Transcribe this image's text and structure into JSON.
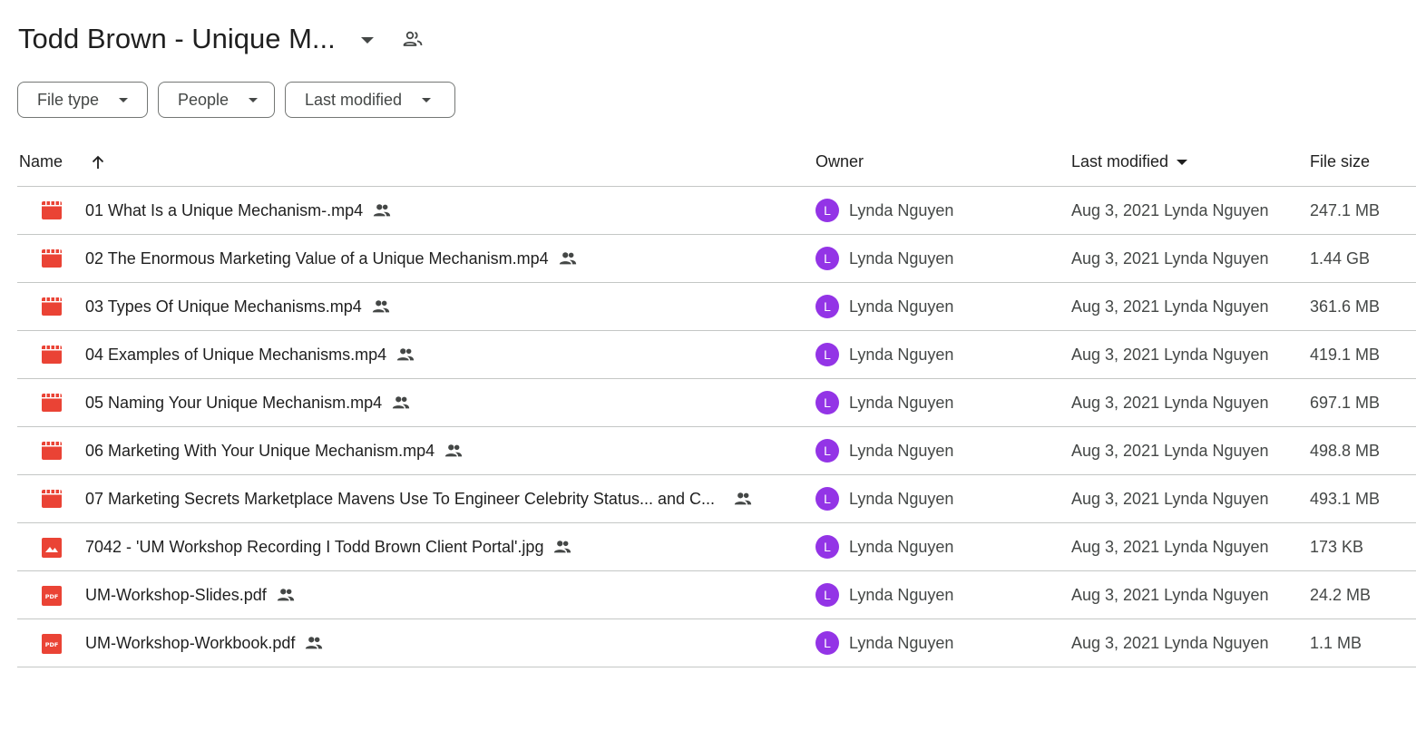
{
  "header": {
    "title": "Todd Brown - Unique M...",
    "title_dropdown_icon": "caret-down-icon",
    "shared_icon": "shared-people-icon"
  },
  "filters": [
    {
      "label": "File type"
    },
    {
      "label": "People"
    },
    {
      "label": "Last modified"
    }
  ],
  "columns": {
    "name": "Name",
    "owner": "Owner",
    "last_modified": "Last modified",
    "file_size": "File size"
  },
  "colors": {
    "video_icon": "#ea4335",
    "image_icon": "#ea4335",
    "pdf_icon": "#ea4335",
    "avatar": "#9334e6"
  },
  "files": [
    {
      "name": "01 What Is a Unique Mechanism-.mp4",
      "type": "video",
      "owner": "Lynda Nguyen",
      "owner_initial": "L",
      "modified": "Aug 3, 2021 Lynda Nguyen",
      "size": "247.1 MB"
    },
    {
      "name": "02 The Enormous Marketing Value of a Unique Mechanism.mp4",
      "type": "video",
      "owner": "Lynda Nguyen",
      "owner_initial": "L",
      "modified": "Aug 3, 2021 Lynda Nguyen",
      "size": "1.44 GB"
    },
    {
      "name": "03 Types Of Unique Mechanisms.mp4",
      "type": "video",
      "owner": "Lynda Nguyen",
      "owner_initial": "L",
      "modified": "Aug 3, 2021 Lynda Nguyen",
      "size": "361.6 MB"
    },
    {
      "name": "04 Examples of Unique Mechanisms.mp4",
      "type": "video",
      "owner": "Lynda Nguyen",
      "owner_initial": "L",
      "modified": "Aug 3, 2021 Lynda Nguyen",
      "size": "419.1 MB"
    },
    {
      "name": "05 Naming Your Unique Mechanism.mp4",
      "type": "video",
      "owner": "Lynda Nguyen",
      "owner_initial": "L",
      "modified": "Aug 3, 2021 Lynda Nguyen",
      "size": "697.1 MB"
    },
    {
      "name": "06 Marketing With Your Unique Mechanism.mp4",
      "type": "video",
      "owner": "Lynda Nguyen",
      "owner_initial": "L",
      "modified": "Aug 3, 2021 Lynda Nguyen",
      "size": "498.8 MB"
    },
    {
      "name": "07 Marketing Secrets Marketplace Mavens Use To Engineer Celebrity Status... and C...",
      "type": "video",
      "owner": "Lynda Nguyen",
      "owner_initial": "L",
      "modified": "Aug 3, 2021 Lynda Nguyen",
      "size": "493.1 MB"
    },
    {
      "name": "7042 - 'UM Workshop Recording I Todd Brown Client Portal'.jpg",
      "type": "image",
      "owner": "Lynda Nguyen",
      "owner_initial": "L",
      "modified": "Aug 3, 2021 Lynda Nguyen",
      "size": "173 KB"
    },
    {
      "name": "UM-Workshop-Slides.pdf",
      "type": "pdf",
      "owner": "Lynda Nguyen",
      "owner_initial": "L",
      "modified": "Aug 3, 2021 Lynda Nguyen",
      "size": "24.2 MB"
    },
    {
      "name": "UM-Workshop-Workbook.pdf",
      "type": "pdf",
      "owner": "Lynda Nguyen",
      "owner_initial": "L",
      "modified": "Aug 3, 2021 Lynda Nguyen",
      "size": "1.1 MB"
    }
  ]
}
